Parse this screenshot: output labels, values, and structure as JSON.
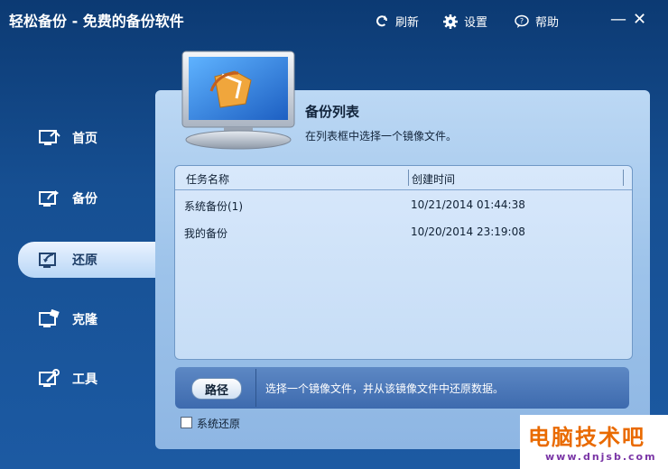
{
  "window": {
    "title": "轻松备份 - 免费的备份软件",
    "minimize_symbol": "—",
    "close_symbol": "✕"
  },
  "toolbar": {
    "refresh_label": "刷新",
    "settings_label": "设置",
    "help_label": "帮助"
  },
  "sidebar": {
    "items": [
      {
        "label": "首页",
        "icon": "monitor-home-icon"
      },
      {
        "label": "备份",
        "icon": "monitor-backup-icon"
      },
      {
        "label": "还原",
        "icon": "monitor-restore-icon",
        "active": true
      },
      {
        "label": "克隆",
        "icon": "monitor-clone-icon"
      },
      {
        "label": "工具",
        "icon": "monitor-tools-icon"
      }
    ]
  },
  "panel": {
    "title": "备份列表",
    "subtitle": "在列表框中选择一个镜像文件。"
  },
  "table": {
    "columns": [
      "任务名称",
      "创建时间"
    ],
    "rows": [
      {
        "name": "系统备份(1)",
        "created": "10/21/2014 01:44:38"
      },
      {
        "name": "我的备份",
        "created": "10/20/2014 23:19:08"
      }
    ]
  },
  "path": {
    "button_label": "路径",
    "hint": "选择一个镜像文件，并从该镜像文件中还原数据。"
  },
  "system_restore": {
    "label": "系统还原",
    "checked": false
  },
  "watermark": {
    "main": "电脑技术吧",
    "sub": "www.dnjsb.com"
  },
  "colors": {
    "background": "#164f92",
    "panel": "#a9cbef",
    "accent": "#e96a00"
  }
}
